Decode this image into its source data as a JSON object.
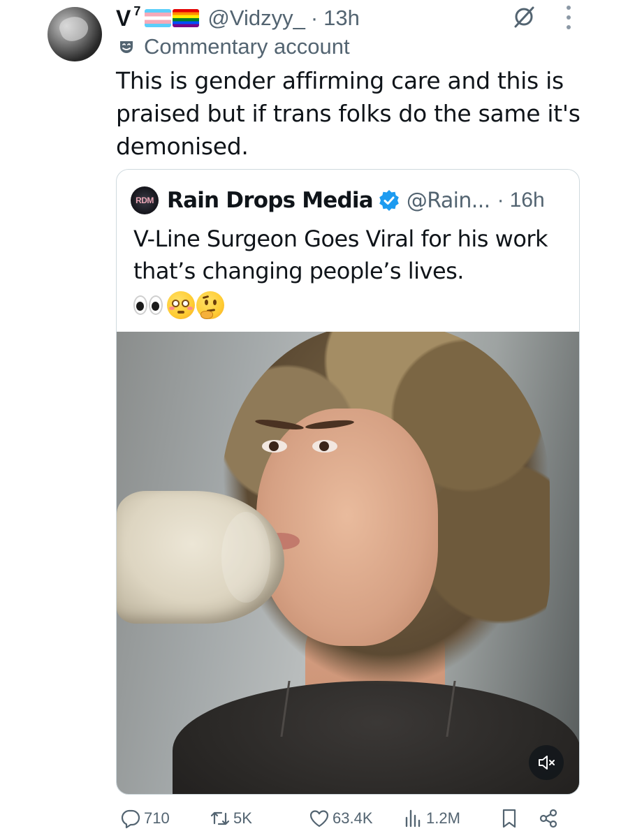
{
  "tweet": {
    "display_name": "V",
    "name_superscript": "7",
    "handle": "@Vidzyy_",
    "separator": "·",
    "time": "13h",
    "label": "Commentary account",
    "text": "This is gender affirming care  and this is praised but if trans folks do the same it's demonised."
  },
  "quote": {
    "avatar_text": "RDM",
    "name": "Rain Drops Media",
    "handle": "@Rain...",
    "separator": "·",
    "time": "16h",
    "text": "V-Line Surgeon Goes Viral for his work that’s changing people’s lives."
  },
  "actions": {
    "replies": "710",
    "reposts": "5K",
    "likes": "63.4K",
    "views": "1.2M"
  },
  "colors": {
    "text_primary": "#0f1419",
    "text_secondary": "#536471",
    "border": "#cfd9de",
    "verified": "#1d9bf0"
  }
}
